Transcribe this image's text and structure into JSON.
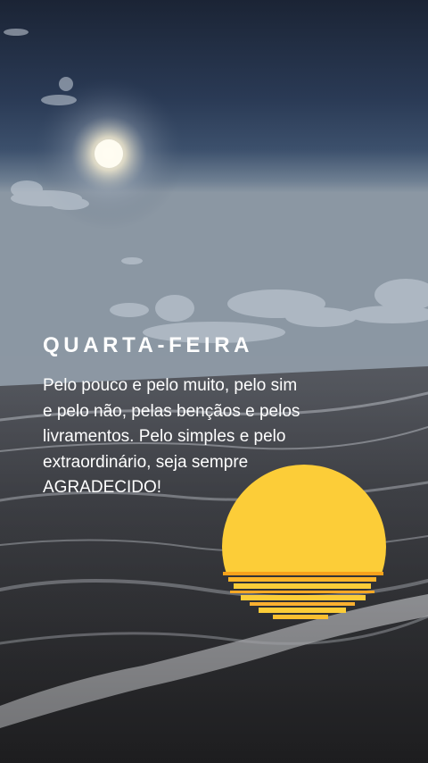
{
  "post": {
    "title": "QUARTA-FEIRA",
    "lines": [
      "Pelo pouco e pelo muito, pelo sim",
      "e pelo não, pelas bençãos e pelos",
      "livramentos. Pelo simples e pelo",
      "extraordinário, seja sempre",
      "AGRADECIDO!"
    ]
  },
  "colors": {
    "sun_yellow": "#fccd38",
    "sun_orange": "#f7a21c",
    "sky_dark": "#1b2638",
    "sea_gray": "#3a3a40",
    "text": "#ffffff"
  },
  "icons": [
    "sunset-icon"
  ]
}
